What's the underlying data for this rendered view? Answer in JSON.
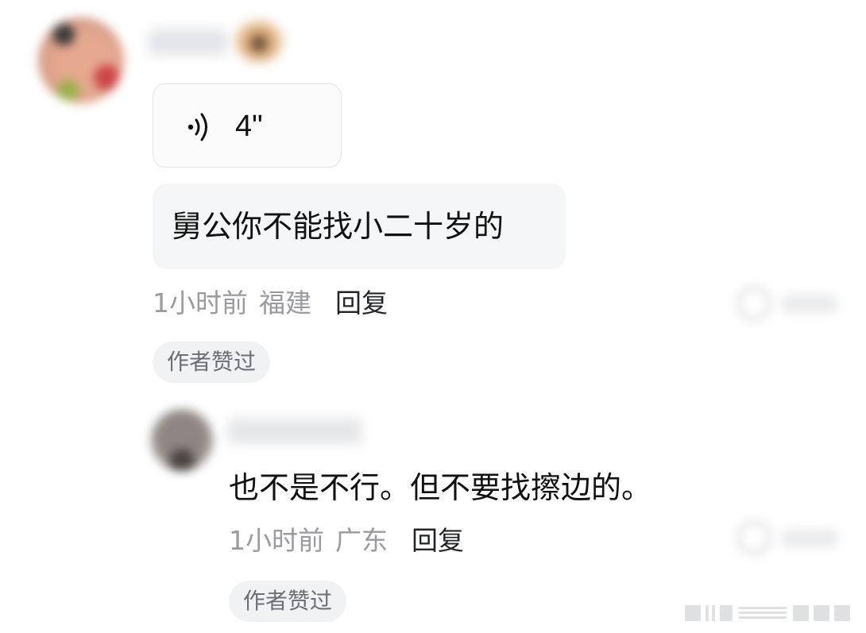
{
  "comment_1": {
    "voice_duration": "4\"",
    "text": "舅公你不能找小二十岁的",
    "time": "1小时前",
    "location": "福建",
    "reply_label": "回复",
    "badge": "作者赞过"
  },
  "comment_2": {
    "text": "也不是不行。但不要找擦边的。",
    "time": "1小时前",
    "location": "广东",
    "reply_label": "回复",
    "badge": "作者赞过"
  },
  "icons": {
    "voice": "voice-wave-icon",
    "like": "like-icon",
    "watermark": "watermark-icon"
  }
}
